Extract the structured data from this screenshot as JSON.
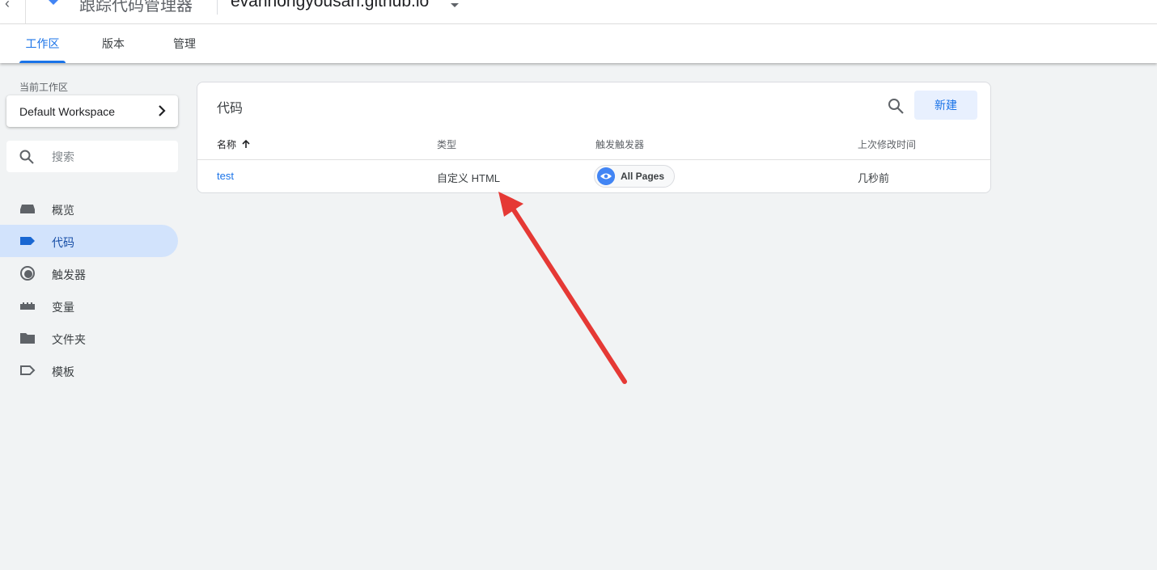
{
  "header": {
    "back_icon": "chevron-left-icon",
    "logo_icon": "gtm-diamond-icon",
    "product_name": "跟踪代码管理器",
    "container_name": "evanhongyousan.github.io",
    "container_caret_icon": "caret-down-icon"
  },
  "tabs": [
    {
      "label": "工作区",
      "active": true
    },
    {
      "label": "版本",
      "active": false
    },
    {
      "label": "管理",
      "active": false
    }
  ],
  "sidebar": {
    "workspace_label": "当前工作区",
    "workspace_name": "Default Workspace",
    "search_placeholder": "搜索",
    "items": [
      {
        "label": "概览",
        "icon": "overview-icon",
        "active": false
      },
      {
        "label": "代码",
        "icon": "tag-icon",
        "active": true
      },
      {
        "label": "触发器",
        "icon": "trigger-icon",
        "active": false
      },
      {
        "label": "变量",
        "icon": "variable-icon",
        "active": false
      },
      {
        "label": "文件夹",
        "icon": "folder-icon",
        "active": false
      },
      {
        "label": "模板",
        "icon": "template-icon",
        "active": false
      }
    ]
  },
  "main": {
    "title": "代码",
    "new_button": "新建",
    "columns": [
      "名称",
      "类型",
      "触发触发器",
      "上次修改时间"
    ],
    "sort_icon": "arrow-up-icon",
    "rows": [
      {
        "name": "test",
        "type": "自定义 HTML",
        "trigger": "All Pages",
        "trigger_icon": "eye-icon",
        "modified": "几秒前"
      }
    ]
  },
  "colors": {
    "accent": "#1a73e8",
    "nav_active_bg": "#d2e3fc",
    "annotation_arrow": "#e53935"
  }
}
